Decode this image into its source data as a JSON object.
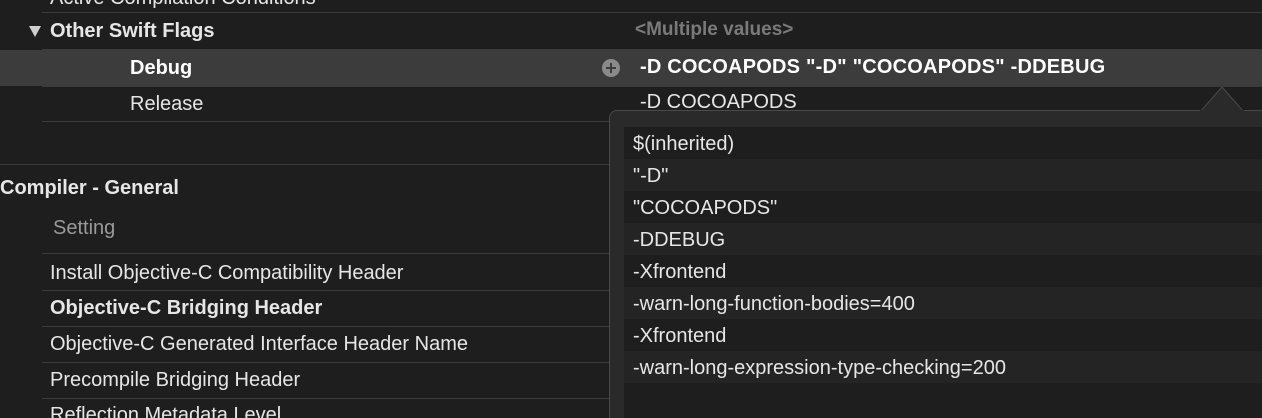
{
  "top_cut_row": {
    "title": "Active Compilation Conditions"
  },
  "other_swift_flags": {
    "title": "Other Swift Flags",
    "summary": "<Multiple values>",
    "debug": {
      "label": "Debug",
      "value": "-D COCOAPODS \"-D\" \"COCOAPODS\" -DDEBUG"
    },
    "release": {
      "label": "Release",
      "value": "-D COCOAPODS"
    }
  },
  "compiler_general": {
    "title": "Compiler - General",
    "column_header": "Setting",
    "rows": [
      {
        "label": "Install Objective-C Compatibility Header"
      },
      {
        "label": "Objective-C Bridging Header"
      },
      {
        "label": "Objective-C Generated Interface Header Name"
      },
      {
        "label": "Precompile Bridging Header"
      },
      {
        "label": "Reflection Metadata Level"
      }
    ]
  },
  "popover": {
    "items": [
      "$(inherited)",
      "\"-D\"",
      "\"COCOAPODS\"",
      "-DDEBUG",
      "-Xfrontend",
      "-warn-long-function-bodies=400",
      "-Xfrontend",
      "-warn-long-expression-type-checking=200"
    ]
  },
  "colors": {
    "background": "#1e1e1e",
    "selected_row": "#3c3c3c",
    "popover_bg": "#2a2a2a",
    "muted_text": "#7a7a7a"
  }
}
